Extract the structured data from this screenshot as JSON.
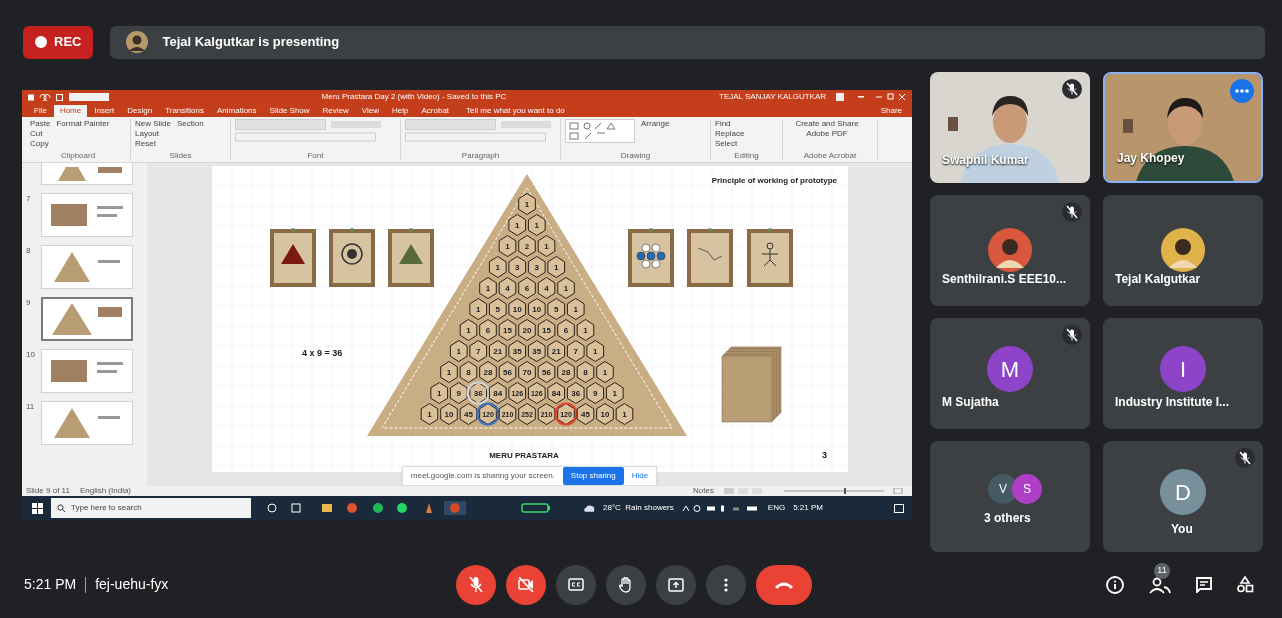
{
  "top_bar": {
    "recording": {
      "label": "REC"
    },
    "presenter_banner": {
      "text": "Tejal Kalgutkar is presenting"
    }
  },
  "shared_screen": {
    "window_title": "Meru Prastara Day 2 (with Video) - Saved to this PC",
    "user_name": "TEJAL SANJAY KALGUTKAR",
    "ribbon_tabs": [
      {
        "label": "File",
        "selected": false
      },
      {
        "label": "Home",
        "selected": true
      },
      {
        "label": "Insert",
        "selected": false
      },
      {
        "label": "Design",
        "selected": false
      },
      {
        "label": "Transitions",
        "selected": false
      },
      {
        "label": "Animations",
        "selected": false
      },
      {
        "label": "Slide Show",
        "selected": false
      },
      {
        "label": "Review",
        "selected": false
      },
      {
        "label": "View",
        "selected": false
      },
      {
        "label": "Help",
        "selected": false
      },
      {
        "label": "Acrobat",
        "selected": false
      }
    ],
    "tell_me": "Tell me what you want to do",
    "share": "Share",
    "ribbon_groups": [
      {
        "label": "Clipboard",
        "buttons": [
          "Paste",
          "Cut",
          "Copy",
          "Format Painter"
        ]
      },
      {
        "label": "Slides",
        "buttons": [
          "New Slide",
          "Layout",
          "Reset",
          "Section"
        ]
      },
      {
        "label": "Font"
      },
      {
        "label": "Paragraph"
      },
      {
        "label": "Drawing",
        "buttons": [
          "Arrange"
        ]
      },
      {
        "label": "Editing",
        "buttons": [
          "Find",
          "Replace",
          "Select"
        ]
      },
      {
        "label": "Adobe Acrobat",
        "buttons": [
          "Create and Share Adobe PDF"
        ]
      }
    ],
    "thumbnails": [
      {
        "selected": false
      },
      {
        "number": "7",
        "selected": false
      },
      {
        "number": "8",
        "selected": false
      },
      {
        "number": "9",
        "selected": true
      },
      {
        "number": "10",
        "selected": false
      },
      {
        "number": "11",
        "selected": false
      }
    ],
    "slide": {
      "title": "Principle of working of prototype",
      "equation": "4 x 9 = 36",
      "footer": "MERU PRASTARA",
      "page_number": "3",
      "pyramid_rows": [
        [
          {
            "text": "1"
          }
        ],
        [
          {
            "text": "1"
          },
          {
            "text": "1"
          }
        ],
        [
          {
            "text": "1"
          },
          {
            "text": "2"
          },
          {
            "text": "1"
          }
        ],
        [
          {
            "text": "1"
          },
          {
            "text": "3"
          },
          {
            "text": "3"
          },
          {
            "text": "1"
          }
        ],
        [
          {
            "text": "1"
          },
          {
            "text": "4"
          },
          {
            "text": "6"
          },
          {
            "text": "4"
          },
          {
            "text": "1"
          }
        ],
        [
          {
            "text": "1"
          },
          {
            "text": "5"
          },
          {
            "text": "10"
          },
          {
            "text": "10"
          },
          {
            "text": "5"
          },
          {
            "text": "1"
          }
        ],
        [
          {
            "text": "1"
          },
          {
            "text": "6"
          },
          {
            "text": "15"
          },
          {
            "text": "20"
          },
          {
            "text": "15"
          },
          {
            "text": "6"
          },
          {
            "text": "1"
          }
        ],
        [
          {
            "text": "1"
          },
          {
            "text": "7"
          },
          {
            "text": "21"
          },
          {
            "text": "35"
          },
          {
            "text": "35"
          },
          {
            "text": "21"
          },
          {
            "text": "7"
          },
          {
            "text": "1"
          }
        ],
        [
          {
            "text": "1"
          },
          {
            "text": "8"
          },
          {
            "text": "28"
          },
          {
            "text": "56"
          },
          {
            "text": "70"
          },
          {
            "text": "56"
          },
          {
            "text": "28"
          },
          {
            "text": "8"
          },
          {
            "text": "1"
          }
        ],
        [
          {
            "text": "1"
          },
          {
            "text": "9"
          },
          {
            "text": "36",
            "color": "#d6d6d6"
          },
          {
            "text": "84"
          },
          {
            "text": "126"
          },
          {
            "text": "126"
          },
          {
            "text": "84"
          },
          {
            "text": "36"
          },
          {
            "text": "9"
          },
          {
            "text": "1"
          }
        ],
        [
          {
            "text": "1"
          },
          {
            "text": "10"
          },
          {
            "text": "45"
          },
          {
            "text": "120",
            "color": "#3a72c0"
          },
          {
            "text": "210"
          },
          {
            "text": "252"
          },
          {
            "text": "210"
          },
          {
            "text": "120",
            "color": "#e0452e"
          },
          {
            "text": "45"
          },
          {
            "text": "10"
          },
          {
            "text": "1"
          }
        ]
      ]
    },
    "status_bar": {
      "slide_info": "Slide 9 of 11",
      "language": "English (India)",
      "notes": "Notes"
    },
    "sharing_bar": {
      "message": "meet.google.com is sharing your screen.",
      "stop": "Stop sharing",
      "hide": "Hide"
    },
    "taskbar": {
      "search_placeholder": "Type here to search",
      "weather": "28°C  Rain showers",
      "language": "ENG",
      "time": "5:21 PM"
    }
  },
  "participants": [
    {
      "kind": "video",
      "name": "Swapnil Kumar",
      "muted": true,
      "selected": false
    },
    {
      "kind": "video",
      "name": "Jay Khopey",
      "muted": false,
      "selected": true
    },
    {
      "name": "Senthilrani.S EEE10...",
      "muted": true,
      "selected": false
    },
    {
      "name": "Tejal Kalgutkar",
      "muted": false,
      "selected": false
    },
    {
      "kind": "letter",
      "name": "M Sujatha",
      "muted": true,
      "selected": false,
      "letter": "M",
      "color": "#8e44c9"
    },
    {
      "kind": "letter",
      "name": "Industry Institute I...",
      "muted": false,
      "selected": false,
      "letter": "I",
      "color": "#8e44c9"
    },
    {
      "kind": "group",
      "name": "3 others",
      "muted": false,
      "selected": false,
      "avatars": [
        {
          "letter": "V",
          "color": "#455a64"
        },
        {
          "letter": "S",
          "color": "#b03fc7"
        }
      ]
    },
    {
      "kind": "letter",
      "name": "You",
      "muted": true,
      "selected": false,
      "letter": "D",
      "color": "#78909c"
    }
  ],
  "bottom_bar": {
    "time": "5:21 PM",
    "meeting_code": "fej-uehu-fyx",
    "controls": [
      {
        "kind": "mic",
        "on": false
      },
      {
        "kind": "camera",
        "on": false
      },
      {
        "kind": "captions",
        "on": false
      },
      {
        "kind": "hand",
        "on": false
      },
      {
        "kind": "present",
        "on": false
      },
      {
        "kind": "more"
      },
      {
        "kind": "leave"
      }
    ],
    "people_count": "11"
  }
}
